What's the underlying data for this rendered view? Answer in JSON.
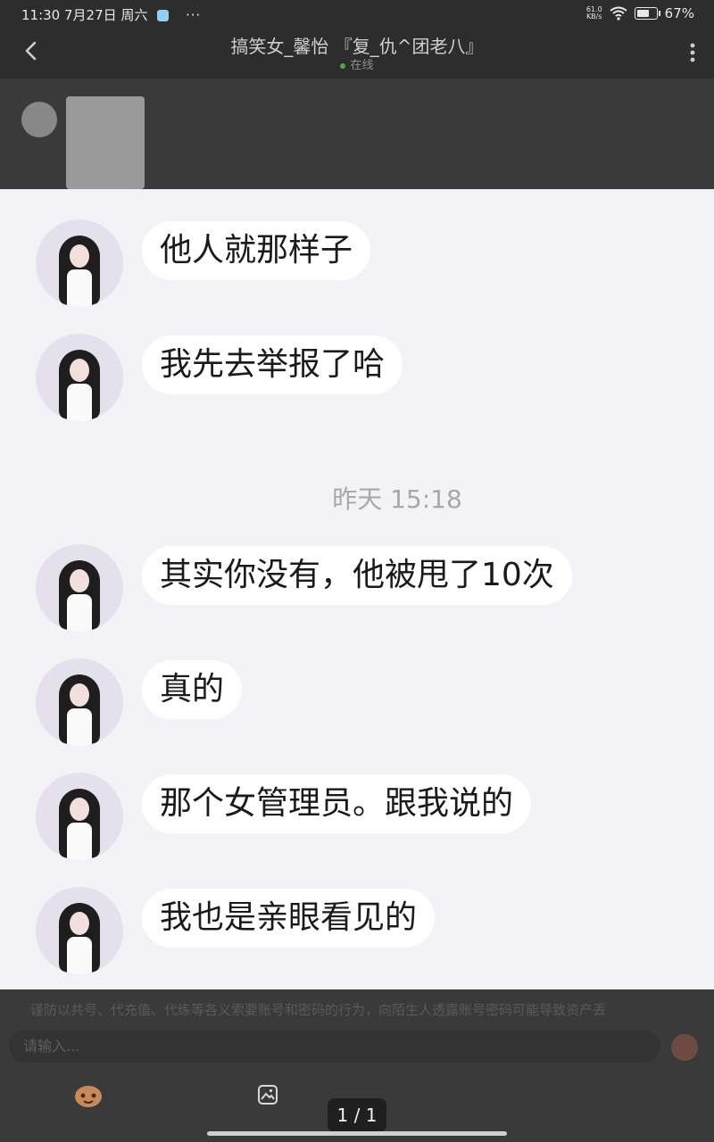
{
  "status_bar": {
    "time": "11:30",
    "date": "7月27日",
    "weekday": "周六",
    "overflow": "···",
    "net_speed_value": "61.0",
    "net_speed_unit": "KB/s",
    "battery": "67%",
    "battery_level": 0.67
  },
  "header": {
    "title": "搞笑女_馨怡 『复_仇^团老八』",
    "status": "在线",
    "status_color": "#49a942"
  },
  "messages": [
    {
      "text": "他人就那样子"
    },
    {
      "text": "我先去举报了哈"
    },
    {
      "text": "其实你没有，他被甩了10次"
    },
    {
      "text": "真的"
    },
    {
      "text": "那个女管理员。跟我说的"
    },
    {
      "text": "我也是亲眼看见的"
    }
  ],
  "timestamp": "昨天 15:18",
  "notice": "谨防以共号、代充值、代练等各义索要账号和密码的行为，向陌生人透露账号密码可能导致资产丢",
  "input": {
    "placeholder": "请输入..."
  },
  "pager": "1 / 1",
  "icons": {
    "back": "back-arrow-icon",
    "menu": "more-vertical-icon",
    "emoji": "emoji-face-icon",
    "image": "image-icon",
    "send": "send-icon"
  }
}
